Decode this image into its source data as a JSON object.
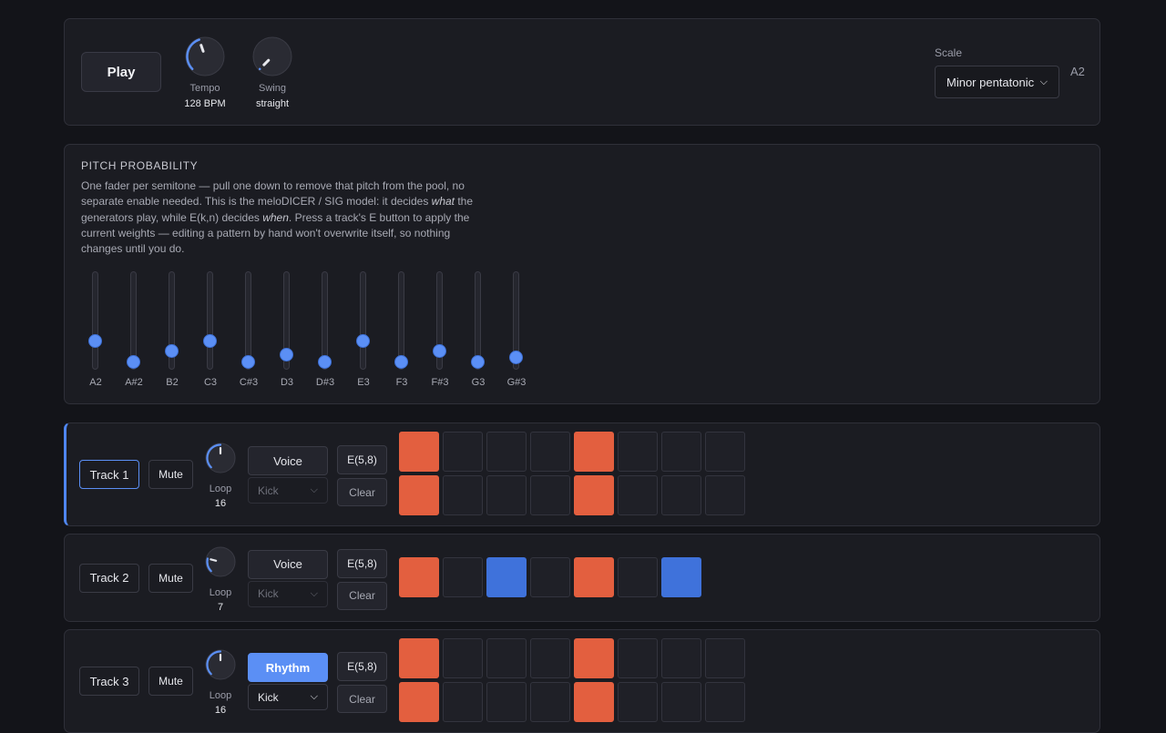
{
  "transport": {
    "play_label": "Play",
    "tempo": {
      "label": "Tempo",
      "value": "128 BPM",
      "level": 0.43
    },
    "swing": {
      "label": "Swing",
      "value": "straight",
      "level": 0.0
    },
    "scale": {
      "label": "Scale",
      "value": "Minor pentatonic"
    },
    "root": "A2"
  },
  "pitch": {
    "title": "PITCH PROBABILITY",
    "desc_1": "One fader per semitone — pull one down to remove that pitch from the pool, no separate enable needed. This is the meloDICER / SIG model: it decides ",
    "desc_em1": "what",
    "desc_2": " the generators play, while E(k,n) decides ",
    "desc_em2": "when",
    "desc_3": ". Press a track's E button to apply the current weights — editing a pattern by hand won't overwrite itself, so nothing changes until you do.",
    "faders": [
      {
        "note": "A2",
        "weight": 0.29
      },
      {
        "note": "A#2",
        "weight": 0.0
      },
      {
        "note": "B2",
        "weight": 0.15
      },
      {
        "note": "C3",
        "weight": 0.29
      },
      {
        "note": "C#3",
        "weight": 0.0
      },
      {
        "note": "D3",
        "weight": 0.1
      },
      {
        "note": "D#3",
        "weight": 0.0
      },
      {
        "note": "E3",
        "weight": 0.29
      },
      {
        "note": "F3",
        "weight": 0.0
      },
      {
        "note": "F#3",
        "weight": 0.15
      },
      {
        "note": "G3",
        "weight": 0.0
      },
      {
        "note": "G#3",
        "weight": 0.06
      }
    ]
  },
  "tracks": [
    {
      "name": "Track 1",
      "mute": "Mute",
      "loop_label": "Loop",
      "loop": "16",
      "loop_level": 0.5,
      "mode": "Voice",
      "mode_active": false,
      "voice": "Kick",
      "voice_enabled": false,
      "euclid": "E(5,8)",
      "clear": "Clear",
      "steps": [
        1,
        0,
        0,
        0,
        1,
        0,
        0,
        0,
        1,
        0,
        0,
        0,
        1,
        0,
        0,
        0
      ]
    },
    {
      "name": "Track 2",
      "mute": "Mute",
      "loop_label": "Loop",
      "loop": "7",
      "loop_level": 0.22,
      "mode": "Voice",
      "mode_active": false,
      "voice": "Kick",
      "voice_enabled": false,
      "euclid": "E(5,8)",
      "clear": "Clear",
      "steps": [
        1,
        0,
        2,
        0,
        1,
        0,
        2
      ]
    },
    {
      "name": "Track 3",
      "mute": "Mute",
      "loop_label": "Loop",
      "loop": "16",
      "loop_level": 0.5,
      "mode": "Rhythm",
      "mode_active": true,
      "voice": "Kick",
      "voice_enabled": true,
      "euclid": "E(5,8)",
      "clear": "Clear",
      "steps": [
        1,
        0,
        0,
        0,
        1,
        0,
        0,
        0,
        1,
        0,
        0,
        0,
        1,
        0,
        0,
        0
      ]
    }
  ],
  "colors": {
    "accent": "#5b8ff5",
    "step_hit": "#e35f3f",
    "step_alt": "#3f72db",
    "panel": "#1b1c22",
    "background": "#131419"
  }
}
